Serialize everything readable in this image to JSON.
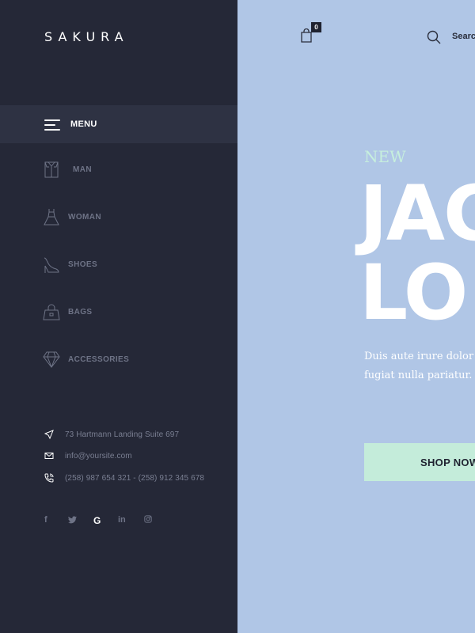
{
  "brand": {
    "logo": "SAKURA"
  },
  "header": {
    "cart_count": "0",
    "search_label": "Search"
  },
  "sidebar": {
    "menu_label": "MENU",
    "items": [
      {
        "label": "MAN",
        "icon": "shirt-icon"
      },
      {
        "label": "WOMAN",
        "icon": "dress-icon"
      },
      {
        "label": "SHOES",
        "icon": "heel-shoe-icon"
      },
      {
        "label": "BAGS",
        "icon": "bag-icon"
      },
      {
        "label": "ACCESSORIES",
        "icon": "diamond-icon"
      }
    ],
    "contact": {
      "address": "73 Hartmann Landing Suite 697",
      "email": "info@yoursite.com",
      "phone": "(258) 987 654 321 - (258) 912 345 678"
    },
    "social": [
      {
        "icon": "facebook-icon",
        "glyph": "f"
      },
      {
        "icon": "twitter-icon",
        "glyph": "🐦"
      },
      {
        "icon": "google-icon",
        "glyph": "G"
      },
      {
        "icon": "linkedin-icon",
        "glyph": "in"
      },
      {
        "icon": "instagram-icon",
        "glyph": "◎"
      }
    ]
  },
  "hero": {
    "tag": "NEW",
    "headline_line1": "JAC",
    "headline_line2": "LO",
    "body_line1": "Duis aute irure dolor in",
    "body_line2": "fugiat nulla pariatur. Ex",
    "cta": "SHOP NOW"
  },
  "colors": {
    "sidebar_bg": "#252837",
    "hero_bg": "#b0c6e6",
    "accent_mint": "#c4ecda"
  }
}
